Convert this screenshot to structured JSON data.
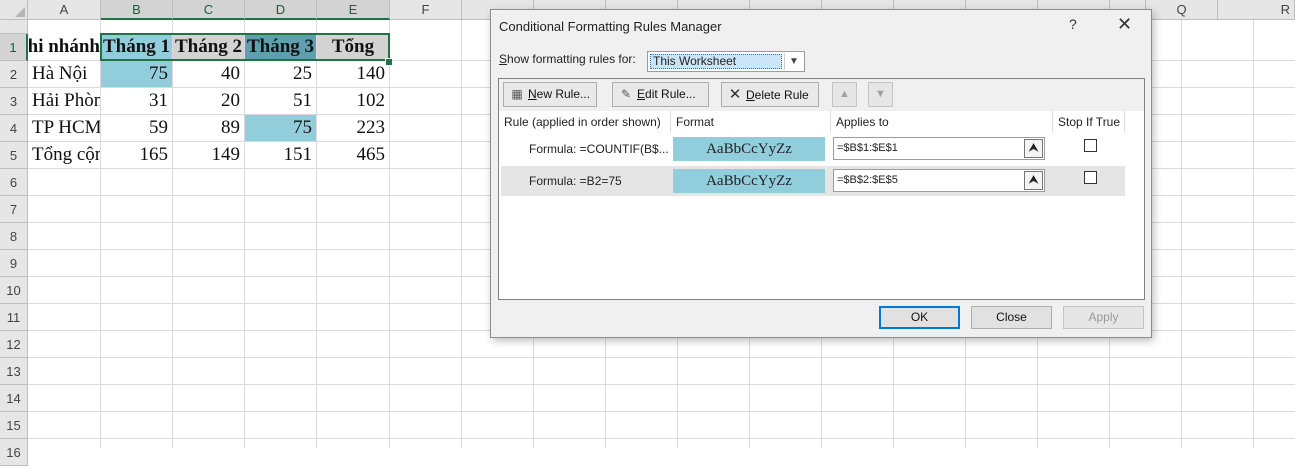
{
  "sheet": {
    "columns": [
      "A",
      "B",
      "C",
      "D",
      "E",
      "F",
      "",
      "",
      "",
      "",
      "",
      "",
      "",
      "",
      "",
      "Q",
      "R"
    ],
    "rows": [
      "1",
      "2",
      "3",
      "4",
      "5",
      "6",
      "7",
      "8",
      "9",
      "10",
      "11",
      "12",
      "13",
      "14",
      "15",
      "16"
    ],
    "cells": {
      "a1": "Chi nhánh",
      "b1": "Tháng 1",
      "c1": "Tháng 2",
      "d1": "Tháng 3",
      "e1": "Tổng",
      "a2": "Hà Nội",
      "b2": "75",
      "c2": "40",
      "d2": "25",
      "e2": "140",
      "a3": "Hải Phòng",
      "b3": "31",
      "c3": "20",
      "d3": "51",
      "e3": "102",
      "a4": "TP HCM",
      "b4": "59",
      "c4": "89",
      "d4": "75",
      "e4": "223",
      "a5": "Tổng cộng",
      "b5": "165",
      "c5": "149",
      "d5": "151",
      "e5": "465"
    },
    "highlight_color": "#92cddc"
  },
  "dialog": {
    "title": "Conditional Formatting Rules Manager",
    "help": "?",
    "close": "✕",
    "show_label_pre": "",
    "show_label_u": "S",
    "show_label_post": "how formatting rules for:",
    "show_value": "This Worksheet",
    "toolbar": {
      "new_u": "N",
      "new_rest": "ew Rule...",
      "edit_u": "E",
      "edit_rest": "dit Rule...",
      "delete_u": "D",
      "delete_rest": "elete Rule"
    },
    "columns": {
      "rule": "Rule (applied in order shown)",
      "format": "Format",
      "applies": "Applies to",
      "stop": "Stop If True"
    },
    "rules": [
      {
        "desc": "Formula: =COUNTIF(B$...",
        "preview": "AaBbCcYyZz",
        "applies": "=$B$1:$E$1",
        "stop": false
      },
      {
        "desc": "Formula: =B2=75",
        "preview": "AaBbCcYyZz",
        "applies": "=$B$2:$E$5",
        "stop": false
      }
    ],
    "buttons": {
      "ok": "OK",
      "close": "Close",
      "apply": "Apply"
    }
  }
}
